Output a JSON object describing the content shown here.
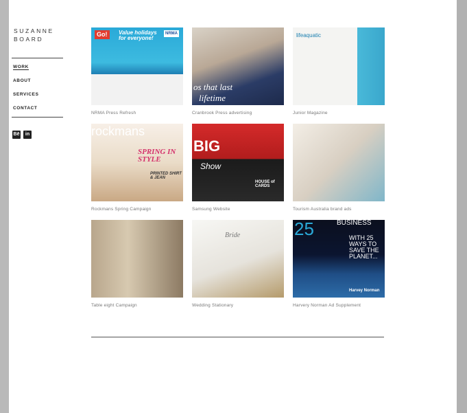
{
  "brand": {
    "line1": "SUZANNE",
    "line2": "BOARD"
  },
  "nav": [
    {
      "label": "WORK",
      "active": true
    },
    {
      "label": "ABOUT",
      "active": false
    },
    {
      "label": "SERVICES",
      "active": false
    },
    {
      "label": "CONTACT",
      "active": false
    }
  ],
  "social": [
    {
      "icon": "behance-icon",
      "glyph": "Bē"
    },
    {
      "icon": "linkedin-icon",
      "glyph": "in"
    }
  ],
  "projects": [
    {
      "caption": "NRMA Press Refresh",
      "art": {
        "a": "Go!",
        "b": "Value holidays for everyone!",
        "c": "NRMA"
      }
    },
    {
      "caption": "Cranbrook Press advertising",
      "art": {
        "a": "os that last",
        "b": "lifetime"
      }
    },
    {
      "caption": "Junior Magazine",
      "art": {
        "a": "lifeaquatic"
      }
    },
    {
      "caption": "Rockmans Spring Campaign",
      "art": {
        "a": "rockmans",
        "b": "SPRING IN STYLE",
        "c": "PRINTED SHIRT & JEAN"
      }
    },
    {
      "caption": "Samsung Website",
      "art": {
        "a": "BIG",
        "b": "Show",
        "c": "HOUSE of CARDS"
      }
    },
    {
      "caption": "Tourism Australia brand ads",
      "art": {}
    },
    {
      "caption": "Table eight Campaign",
      "art": {}
    },
    {
      "caption": "Wedding Stationary",
      "art": {
        "a": "Bride"
      }
    },
    {
      "caption": "Harvery Norman Ad Supplement",
      "art": {
        "a": "25",
        "b": "BUSINESS",
        "c": "WITH 25 WAYS TO SAVE THE PLANET...",
        "d": "Harvey Norman"
      }
    }
  ]
}
